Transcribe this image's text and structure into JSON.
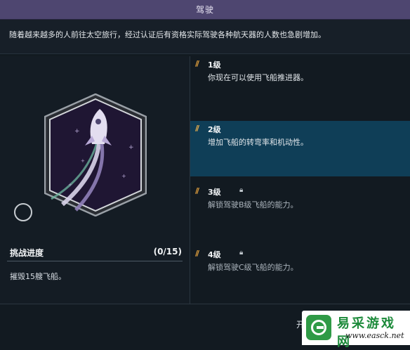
{
  "header": {
    "title": "驾驶"
  },
  "intro": {
    "text": "随着越来越多的人前往太空旅行，经过认证后有资格实际驾驶各种航天器的人数也急剧增加。"
  },
  "challenge": {
    "label": "挑战进度",
    "count": "(0/15)",
    "description": "摧毁15艘飞船。"
  },
  "levels": [
    {
      "marker": "//",
      "title": "1级",
      "locked": false,
      "active": false,
      "description": "你现在可以使用飞船推进器。"
    },
    {
      "marker": "//",
      "title": "2级",
      "locked": false,
      "active": true,
      "description": "增加飞船的转弯率和机动性。"
    },
    {
      "marker": "//",
      "title": "3级",
      "locked": true,
      "active": false,
      "description": "解锁驾驶B级飞船的能力。"
    },
    {
      "marker": "//",
      "title": "4级",
      "locked": true,
      "active": false,
      "description": "解锁驾驶C级飞船的能力。"
    }
  ],
  "footer": {
    "partial_text": "开"
  },
  "watermark": {
    "name": "易采游戏网",
    "url": "www.easck.net"
  },
  "colors": {
    "header_bg": "#4e4670",
    "panel_bg": "#141c24",
    "active_row_bg": "#0f3e57",
    "accent_orange": "#e7a33e",
    "badge_bg": "#1f1633"
  },
  "icons": {
    "lock": "lock-icon",
    "skill": "rocket-badge-icon",
    "select": "radio-circle-icon"
  }
}
